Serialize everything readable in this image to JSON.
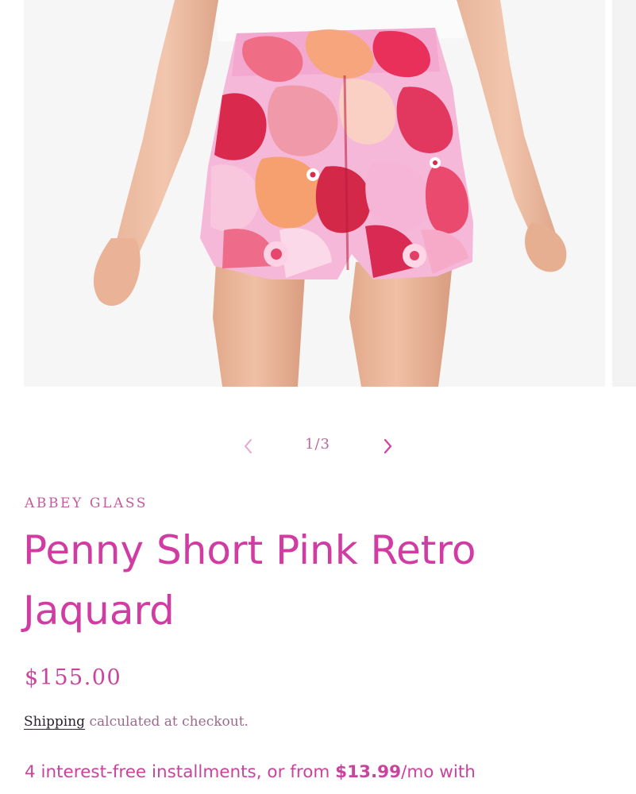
{
  "colors": {
    "accent": "#d03ca2",
    "vendor": "#c25b9c",
    "muted_text": "#9a6a8a",
    "link_text": "#2a2230",
    "chevron": "#d63ea3"
  },
  "gallery": {
    "image_alt": "Penny Short Pink Retro Jaquard",
    "counter": "1/3",
    "prev_icon": "chevron-left-icon",
    "next_icon": "chevron-right-icon"
  },
  "product": {
    "vendor": "ABBEY GLASS",
    "title": "Penny Short Pink Retro Jaquard",
    "price": "$155.00",
    "shipping_link": "Shipping",
    "shipping_text": " calculated at checkout."
  },
  "installments": {
    "prefix": "4 interest-free installments, or from ",
    "amount": "$13.99",
    "suffix": "/mo with"
  }
}
